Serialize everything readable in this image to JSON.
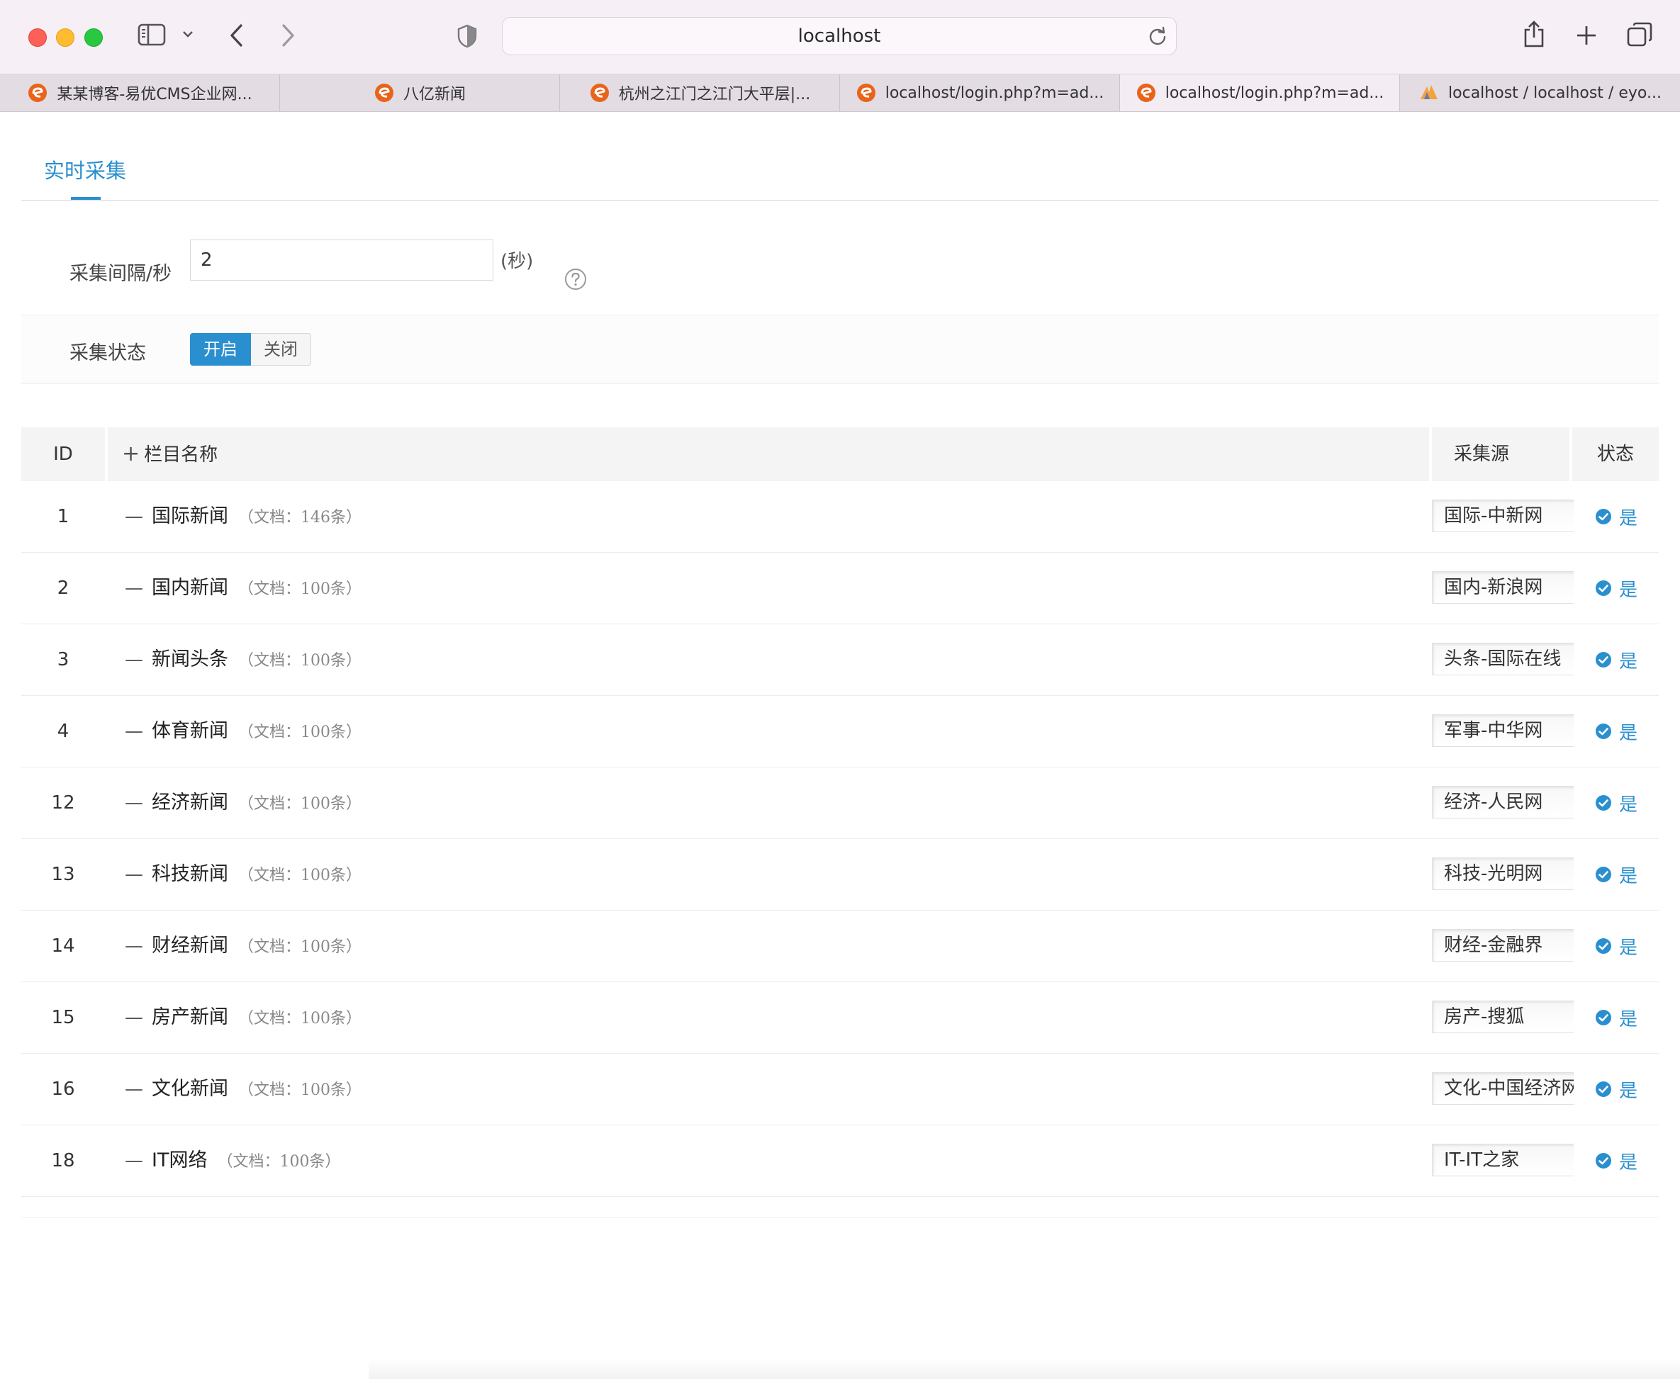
{
  "browser": {
    "address": "localhost",
    "tabs": [
      {
        "label": "某某博客-易优CMS企业网...",
        "icon": "eyou-logo-icon",
        "active": false
      },
      {
        "label": "八亿新闻",
        "icon": "eyou-logo-icon",
        "active": false
      },
      {
        "label": "杭州之江门之江门大平层|...",
        "icon": "eyou-logo-icon",
        "active": false
      },
      {
        "label": "localhost/login.php?m=ad...",
        "icon": "eyou-logo-icon",
        "active": false
      },
      {
        "label": "localhost/login.php?m=ad...",
        "icon": "eyou-logo-icon",
        "active": true
      },
      {
        "label": "localhost / localhost / eyo...",
        "icon": "phpmyadmin-logo-icon",
        "active": false
      }
    ],
    "accent": "#2a8fcf"
  },
  "page": {
    "tab_label": "实时采集",
    "interval_label": "采集间隔/秒",
    "interval_value": "2",
    "interval_unit": "(秒)",
    "status_label": "采集状态",
    "switch_on": "开启",
    "switch_off": "关闭"
  },
  "table": {
    "headers": {
      "id": "ID",
      "name": "栏目名称",
      "source": "采集源",
      "status": "状态"
    },
    "rows": [
      {
        "id": "1",
        "name": "国际新闻",
        "count": "（文档：146条）",
        "source": "国际-中新网",
        "status": "是"
      },
      {
        "id": "2",
        "name": "国内新闻",
        "count": "（文档：100条）",
        "source": "国内-新浪网",
        "status": "是"
      },
      {
        "id": "3",
        "name": "新闻头条",
        "count": "（文档：100条）",
        "source": "头条-国际在线",
        "status": "是"
      },
      {
        "id": "4",
        "name": "体育新闻",
        "count": "（文档：100条）",
        "source": "军事-中华网",
        "status": "是"
      },
      {
        "id": "12",
        "name": "经济新闻",
        "count": "（文档：100条）",
        "source": "经济-人民网",
        "status": "是"
      },
      {
        "id": "13",
        "name": "科技新闻",
        "count": "（文档：100条）",
        "source": "科技-光明网",
        "status": "是"
      },
      {
        "id": "14",
        "name": "财经新闻",
        "count": "（文档：100条）",
        "source": "财经-金融界",
        "status": "是"
      },
      {
        "id": "15",
        "name": "房产新闻",
        "count": "（文档：100条）",
        "source": "房产-搜狐",
        "status": "是"
      },
      {
        "id": "16",
        "name": "文化新闻",
        "count": "（文档：100条）",
        "source": "文化-中国经济网",
        "status": "是"
      },
      {
        "id": "18",
        "name": "IT网络",
        "count": "（文档：100条）",
        "source": "IT-IT之家",
        "status": "是"
      }
    ]
  }
}
